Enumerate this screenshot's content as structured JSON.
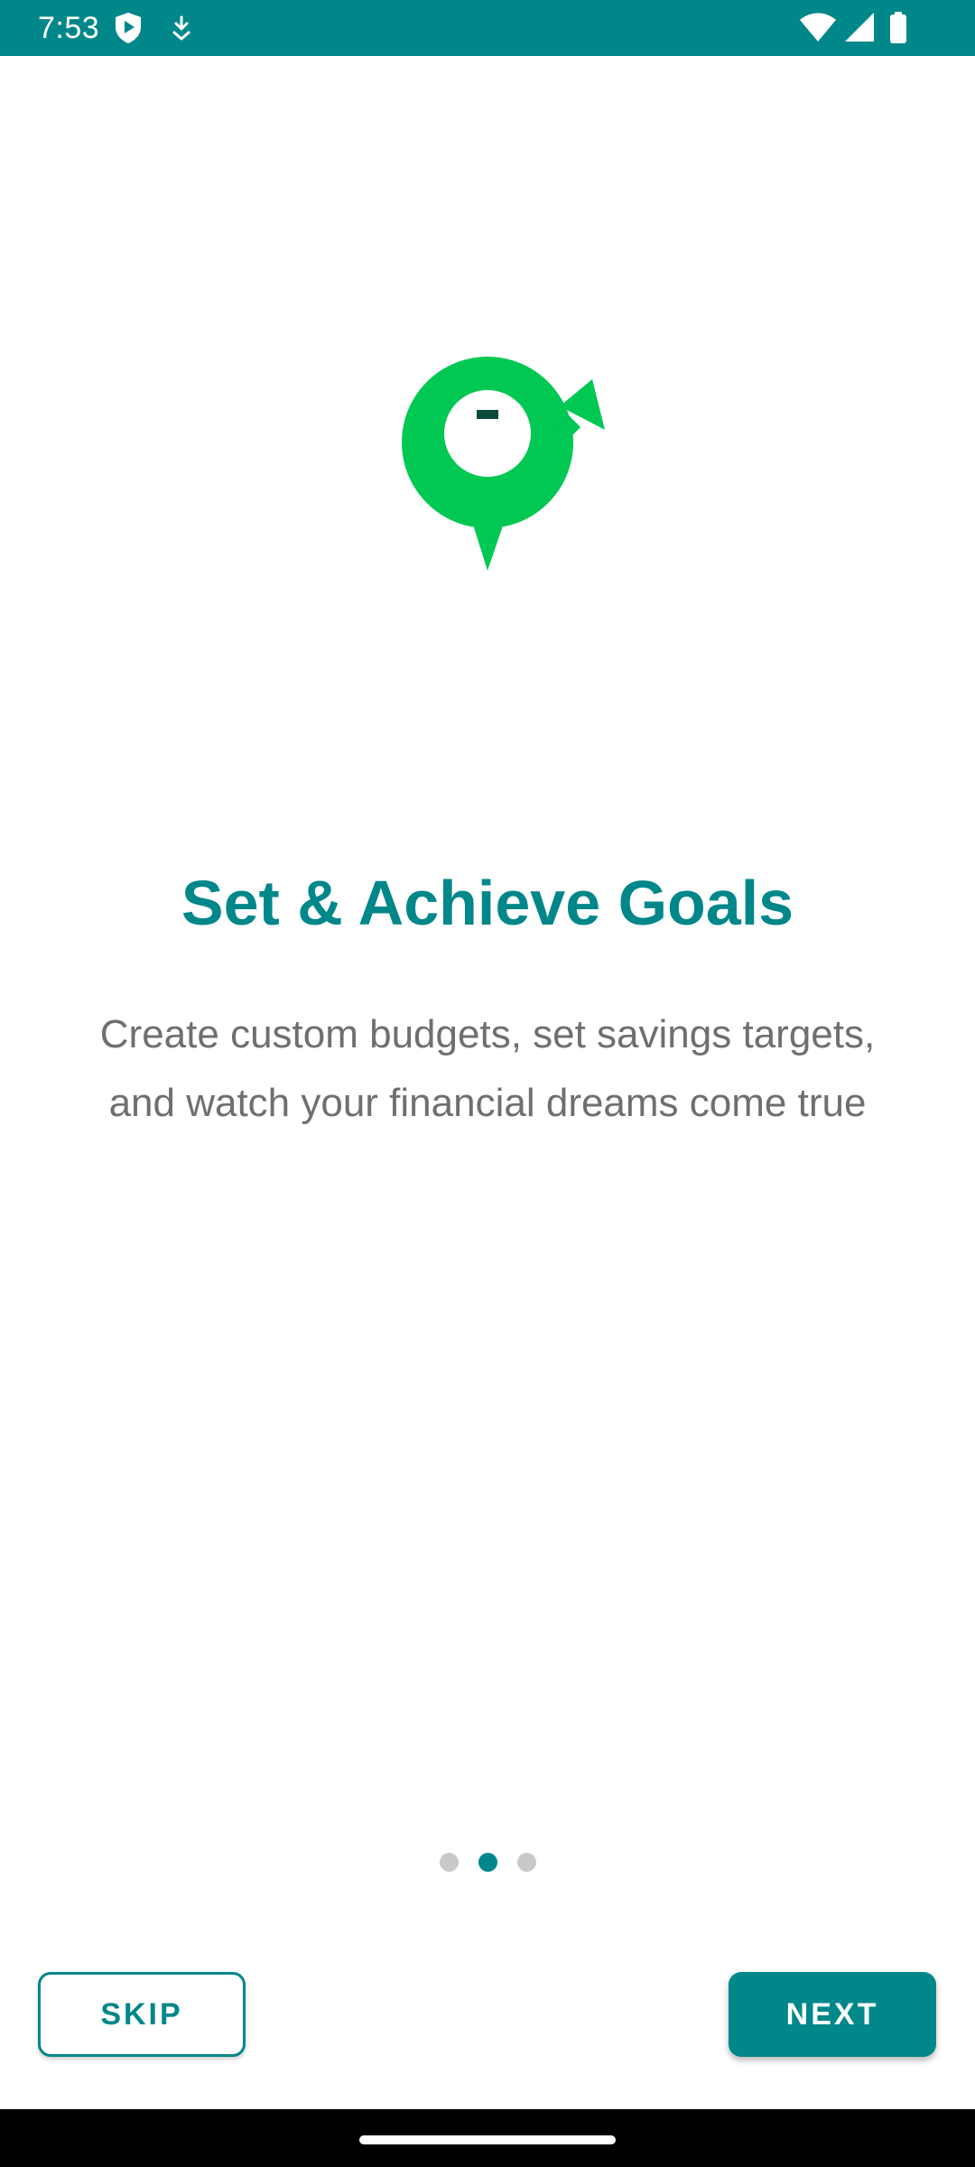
{
  "status_bar": {
    "time": "7:53",
    "bg_color": "#00878a",
    "icons_left": [
      "play-protect-icon",
      "download-icon"
    ],
    "icons_right": [
      "wifi-icon",
      "signal-icon",
      "battery-icon"
    ]
  },
  "onboarding": {
    "illustration_icon": "goal-target-icon",
    "illustration_color": "#00c853",
    "title": "Set & Achieve Goals",
    "description": "Create custom budgets, set savings targets, and watch your financial dreams come true",
    "page_indicator": {
      "total": 3,
      "active_index": 1
    }
  },
  "actions": {
    "skip_label": "SKIP",
    "next_label": "NEXT"
  },
  "colors": {
    "accent": "#00878a",
    "description_text": "#6f6f6f",
    "inactive_dot": "#c9c9c9"
  }
}
